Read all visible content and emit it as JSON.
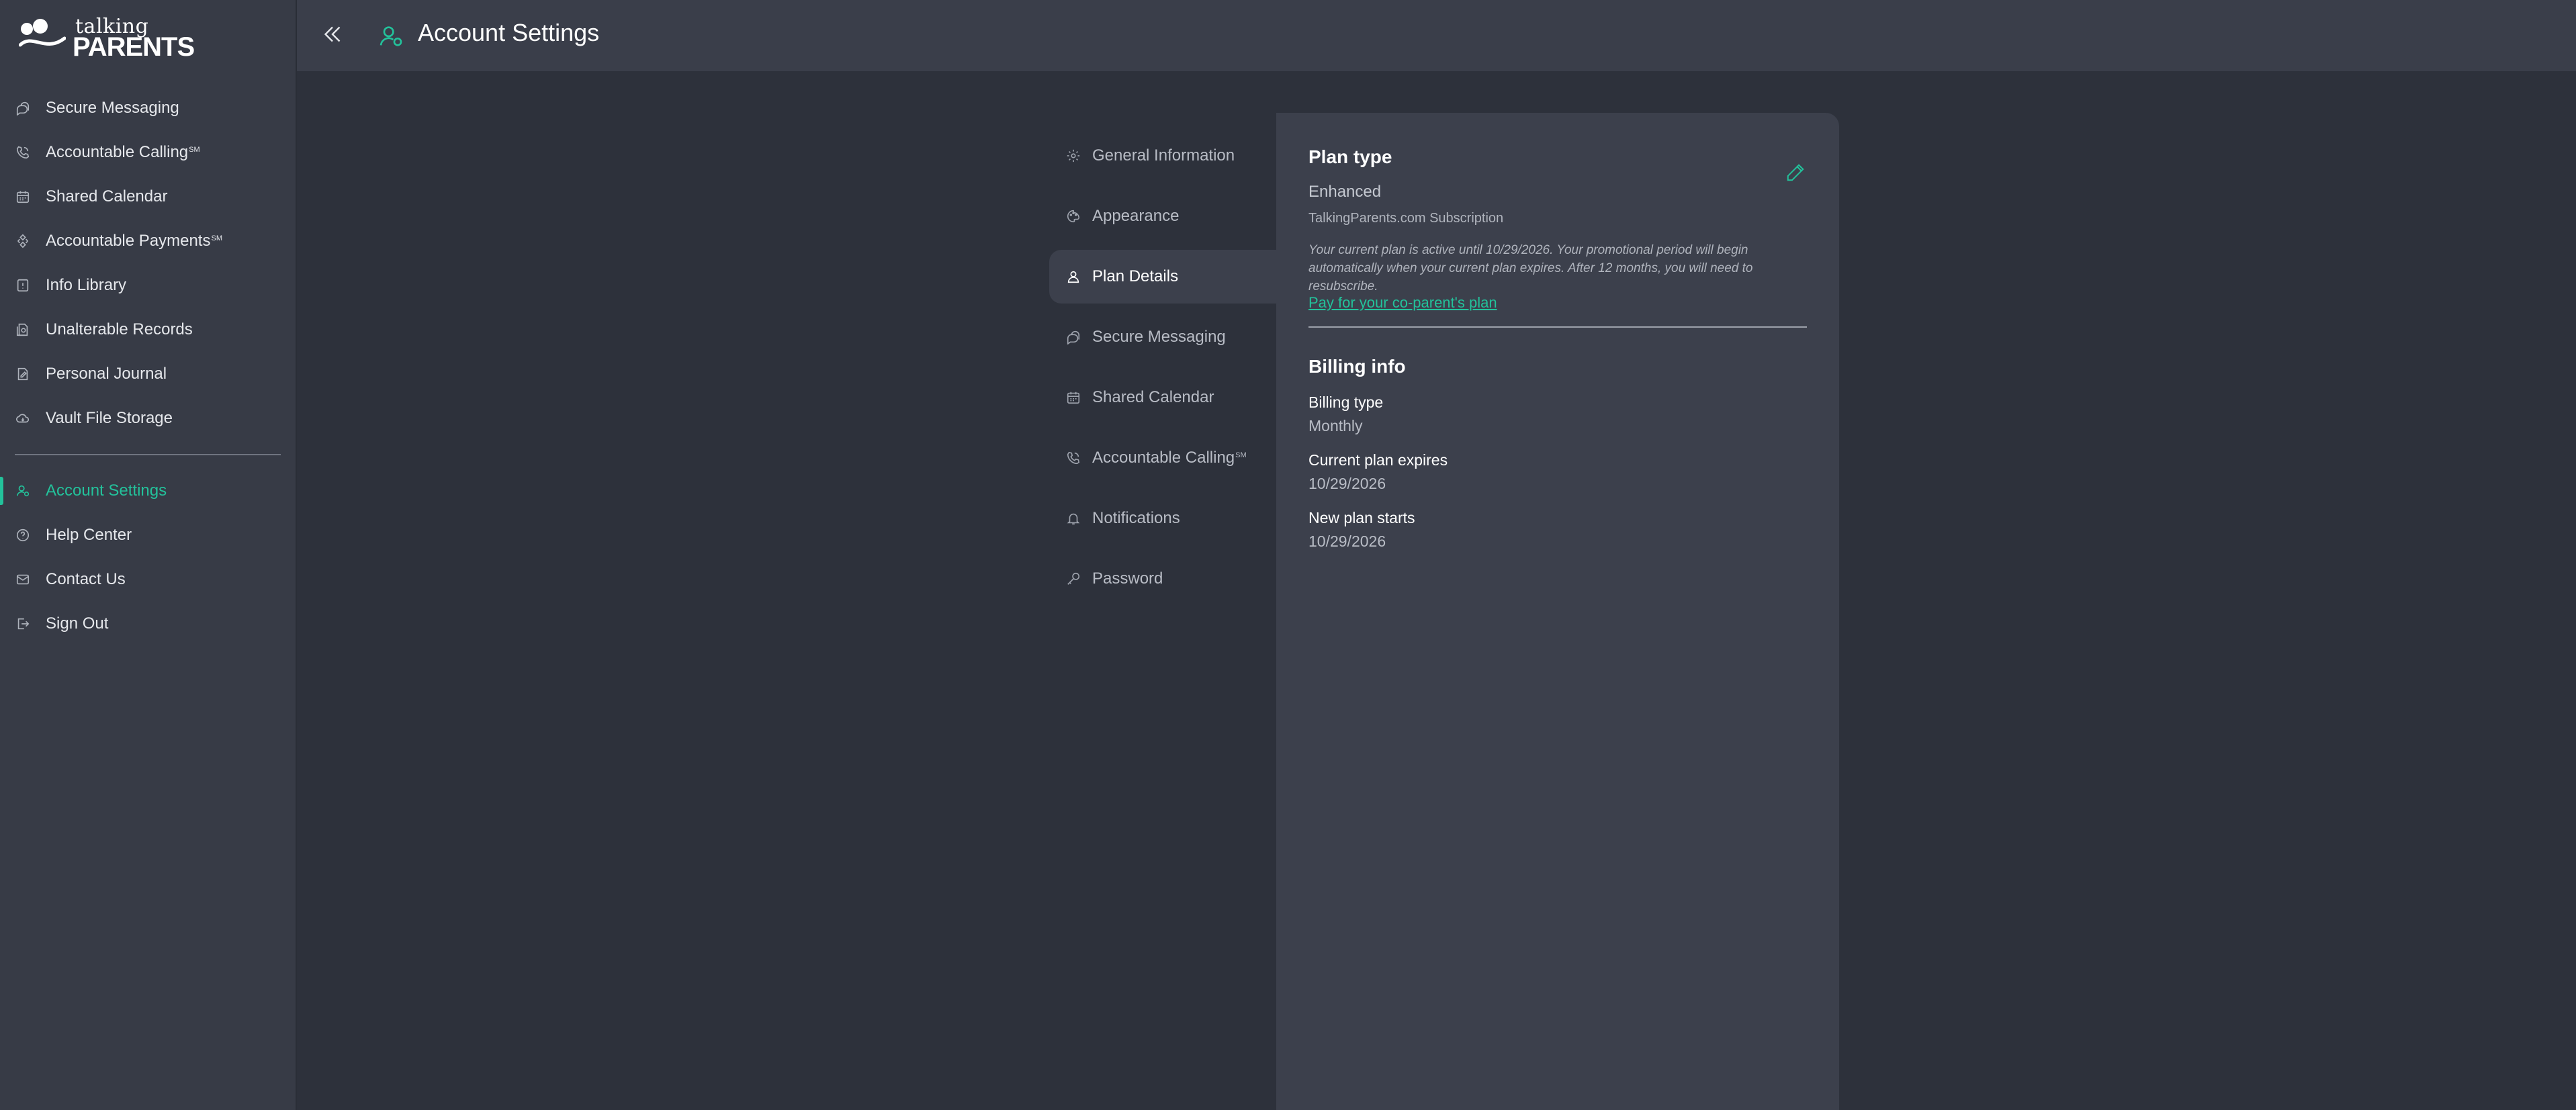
{
  "app": {
    "logo_top": "talking",
    "logo_bottom": "PARENTS"
  },
  "sidebar": {
    "items": [
      {
        "label": "Secure Messaging",
        "sup": ""
      },
      {
        "label": "Accountable Calling",
        "sup": "SM"
      },
      {
        "label": "Shared Calendar",
        "sup": ""
      },
      {
        "label": "Accountable Payments",
        "sup": "SM"
      },
      {
        "label": "Info Library",
        "sup": ""
      },
      {
        "label": "Unalterable Records",
        "sup": ""
      },
      {
        "label": "Personal Journal",
        "sup": ""
      },
      {
        "label": "Vault File Storage",
        "sup": ""
      }
    ],
    "bottom_items": [
      {
        "label": "Account Settings"
      },
      {
        "label": "Help Center"
      },
      {
        "label": "Contact Us"
      },
      {
        "label": "Sign Out"
      }
    ]
  },
  "header": {
    "title": "Account Settings"
  },
  "settings_nav": {
    "items": [
      {
        "label": "General Information",
        "sup": ""
      },
      {
        "label": "Appearance",
        "sup": ""
      },
      {
        "label": "Plan Details",
        "sup": ""
      },
      {
        "label": "Secure Messaging",
        "sup": ""
      },
      {
        "label": "Shared Calendar",
        "sup": ""
      },
      {
        "label": "Accountable Calling",
        "sup": "SM"
      },
      {
        "label": "Notifications",
        "sup": ""
      },
      {
        "label": "Password",
        "sup": ""
      }
    ]
  },
  "plan": {
    "title": "Plan type",
    "value": "Enhanced",
    "subscription": "TalkingParents.com Subscription",
    "note": "Your current plan is active until 10/29/2026. Your promotional period will begin automatically when your current plan expires. After 12 months, you will need to resubscribe.",
    "link": "Pay for your co-parent's plan"
  },
  "billing": {
    "title": "Billing info",
    "fields": [
      {
        "label": "Billing type",
        "value": "Monthly"
      },
      {
        "label": "Current plan expires",
        "value": "10/29/2026"
      },
      {
        "label": "New plan starts",
        "value": "10/29/2026"
      }
    ]
  },
  "colors": {
    "accent": "#23c29b",
    "sidebar_bg": "#373b46",
    "page_bg": "#2d313b",
    "panel_bg": "#3c404c"
  }
}
